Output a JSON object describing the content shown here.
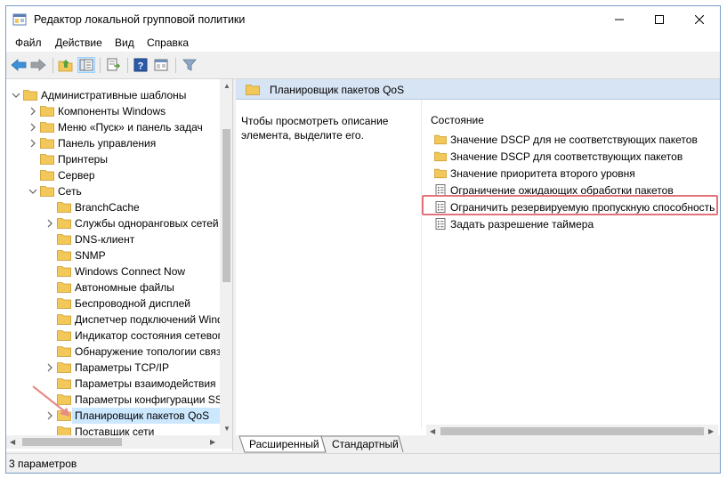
{
  "window": {
    "title": "Редактор локальной групповой политики",
    "controls": {
      "minimize": "—",
      "maximize": "☐",
      "close": "✕"
    }
  },
  "menu": {
    "items": [
      {
        "label": "Файл"
      },
      {
        "label": "Действие"
      },
      {
        "label": "Вид"
      },
      {
        "label": "Справка"
      }
    ]
  },
  "toolbar": {
    "buttons": [
      {
        "icon": "back-arrow-icon"
      },
      {
        "icon": "forward-arrow-icon"
      },
      {
        "icon": "up-folder-icon"
      },
      {
        "icon": "show-hide-tree-icon"
      },
      {
        "icon": "export-list-icon"
      },
      {
        "icon": "help-icon"
      },
      {
        "icon": "properties-pane-icon"
      },
      {
        "icon": "filter-icon"
      }
    ]
  },
  "tree": {
    "items": [
      {
        "label": "Административные шаблоны",
        "level": 0,
        "expander": "open"
      },
      {
        "label": "Компоненты Windows",
        "level": 1,
        "expander": "closed"
      },
      {
        "label": "Меню «Пуск» и панель задач",
        "level": 1,
        "expander": "closed"
      },
      {
        "label": "Панель управления",
        "level": 1,
        "expander": "closed"
      },
      {
        "label": "Принтеры",
        "level": 1,
        "expander": "none"
      },
      {
        "label": "Сервер",
        "level": 1,
        "expander": "none"
      },
      {
        "label": "Сеть",
        "level": 1,
        "expander": "open"
      },
      {
        "label": "BranchCache",
        "level": 2,
        "expander": "none"
      },
      {
        "label": "Службы одноранговых сетей",
        "level": 2,
        "expander": "closed"
      },
      {
        "label": "DNS-клиент",
        "level": 2,
        "expander": "none"
      },
      {
        "label": "SNMP",
        "level": 2,
        "expander": "none"
      },
      {
        "label": "Windows Connect Now",
        "level": 2,
        "expander": "none"
      },
      {
        "label": "Автономные файлы",
        "level": 2,
        "expander": "none"
      },
      {
        "label": "Беспроводной дисплей",
        "level": 2,
        "expander": "none"
      },
      {
        "label": "Диспетчер подключений Windows",
        "level": 2,
        "expander": "none"
      },
      {
        "label": "Индикатор состояния сетевого подключения",
        "level": 2,
        "expander": "none"
      },
      {
        "label": "Обнаружение топологии связи",
        "level": 2,
        "expander": "none"
      },
      {
        "label": "Параметры TCP/IP",
        "level": 2,
        "expander": "closed"
      },
      {
        "label": "Параметры взаимодействия",
        "level": 2,
        "expander": "none"
      },
      {
        "label": "Параметры конфигурации SSL",
        "level": 2,
        "expander": "none"
      },
      {
        "label": "Планировщик пакетов QoS",
        "level": 2,
        "expander": "closed",
        "selected": true
      },
      {
        "label": "Поставщик сети",
        "level": 2,
        "expander": "none"
      }
    ]
  },
  "right_pane": {
    "header_title": "Планировщик пакетов QoS",
    "description": "Чтобы просмотреть описание элемента, выделите его.",
    "column_header": "Состояние",
    "items": [
      {
        "label": "Значение DSCP для не соответствующих пакетов",
        "icon": "folder-icon"
      },
      {
        "label": "Значение DSCP для соответствующих пакетов",
        "icon": "folder-icon"
      },
      {
        "label": "Значение приоритета второго уровня",
        "icon": "folder-icon"
      },
      {
        "label": "Ограничение ожидающих обработки пакетов",
        "icon": "policy-setting-icon"
      },
      {
        "label": "Ограничить резервируемую пропускную способность",
        "icon": "policy-setting-icon",
        "highlighted": true
      },
      {
        "label": "Задать разрешение таймера",
        "icon": "policy-setting-icon"
      }
    ]
  },
  "tabs": [
    {
      "label": "Расширенный",
      "active": true
    },
    {
      "label": "Стандартный",
      "active": false
    }
  ],
  "status": {
    "text": "3 параметров"
  },
  "colors": {
    "header_blue": "#d6e4f3",
    "selection": "#cce8ff",
    "highlight_red": "#e3737a",
    "folder_yellow": "#f3c85a"
  }
}
